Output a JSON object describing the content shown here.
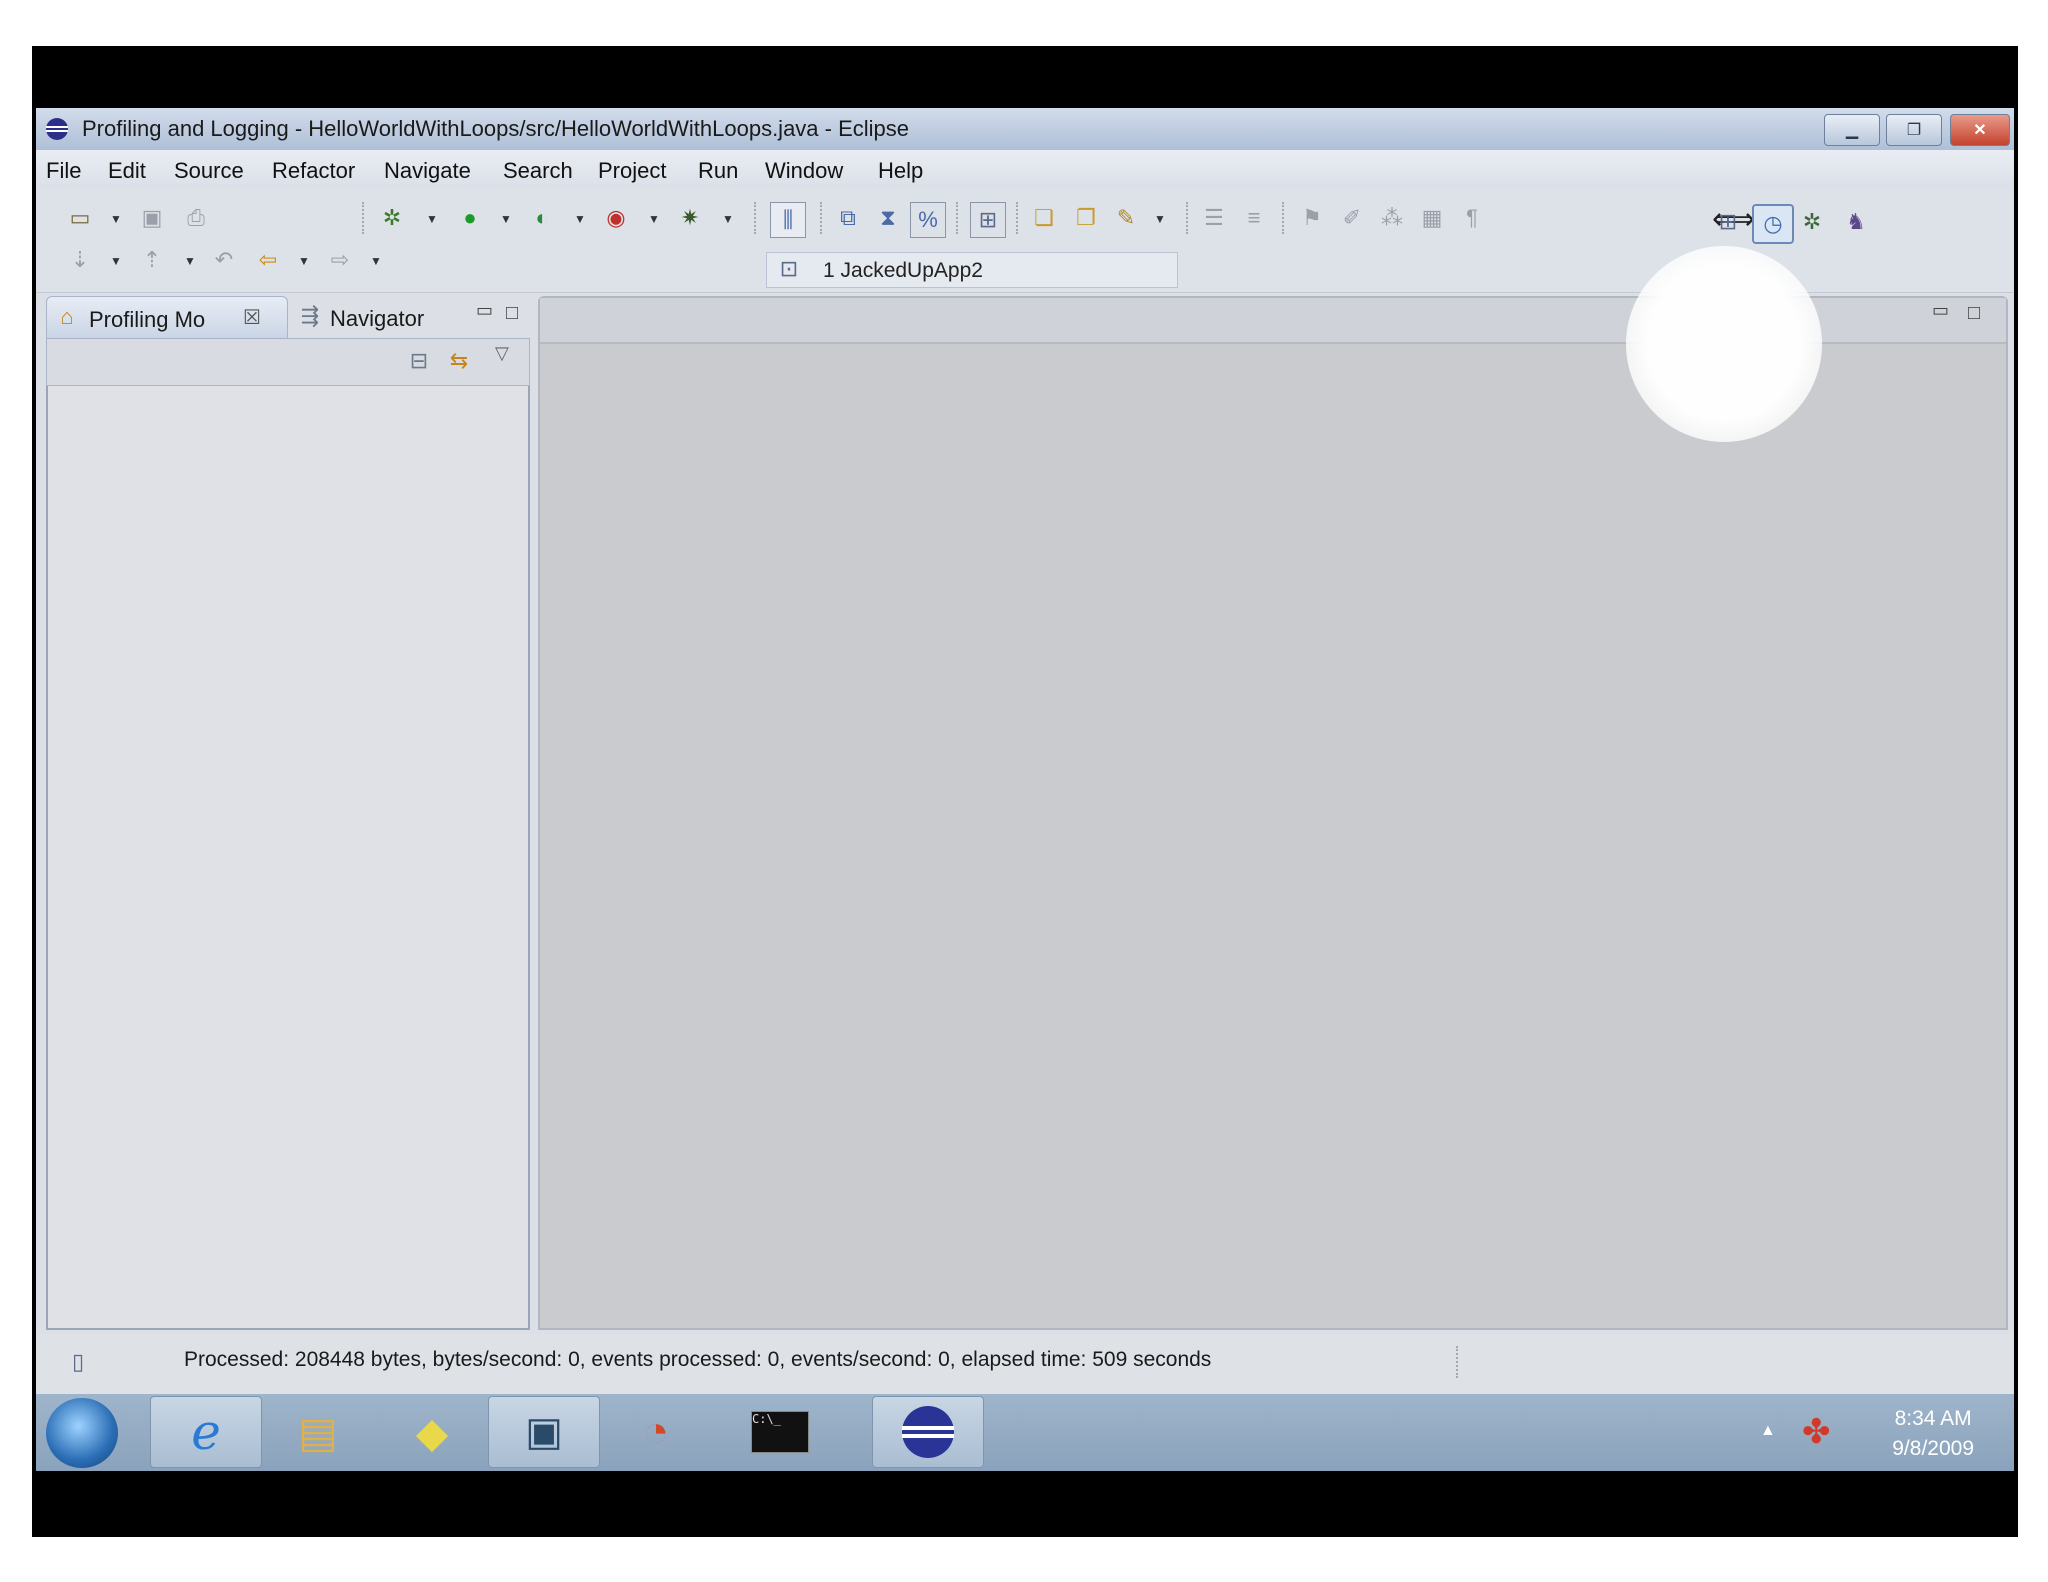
{
  "window": {
    "title": "Profiling and Logging - HelloWorldWithLoops/src/HelloWorldWithLoops.java - Eclipse",
    "app_icon": "eclipse-icon",
    "controls": {
      "minimize": "minimize-icon",
      "restore": "restore-icon",
      "close": "close-icon"
    }
  },
  "menu": {
    "items": [
      "File",
      "Edit",
      "Source",
      "Refactor",
      "Navigate",
      "Search",
      "Project",
      "Run",
      "Window",
      "Help"
    ]
  },
  "toolbar": {
    "launch_item": "1 JackedUpApp2"
  },
  "left_panel": {
    "tabs": [
      {
        "label": "Profiling Mo",
        "icon": "profiling-monitor-icon",
        "active": true
      },
      {
        "label": "Navigator",
        "icon": "navigator-icon",
        "active": false
      }
    ]
  },
  "status_bar": {
    "text": "Processed: 208448 bytes, bytes/second: 0, events processed: 0, events/second: 0, elapsed time: 509 seconds"
  },
  "taskbar": {
    "apps": [
      "start-orb",
      "internet-explorer-icon",
      "windows-explorer-icon",
      "sticky-notes-icon",
      "remote-desktop-icon",
      "performance-icon",
      "command-prompt-icon",
      "eclipse-icon"
    ],
    "clock": {
      "time": "8:34 AM",
      "date": "9/8/2009"
    }
  }
}
